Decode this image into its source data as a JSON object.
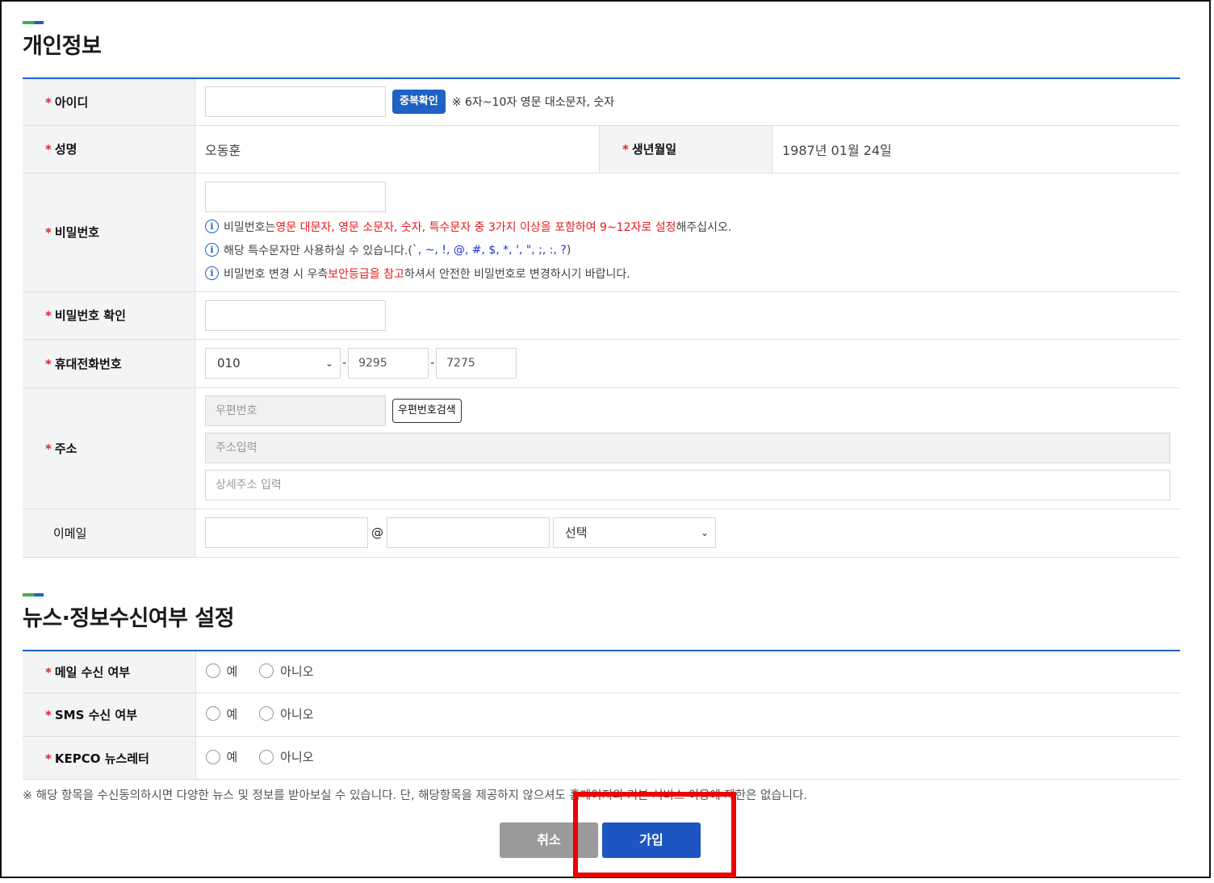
{
  "personal": {
    "title": "개인정보",
    "id_label": "아이디",
    "id_check_button": "중복확인",
    "id_note": "※ 6자~10자 영문 대소문자, 숫자",
    "name_label": "성명",
    "name_value": "오동훈",
    "birth_label": "생년월일",
    "birth_value": "1987년 01월 24일",
    "password_label": "비밀번호",
    "pw_notes": {
      "line1_a": "비밀번호는 ",
      "line1_red": "영문 대문자, 영문 소문자, 숫자, 특수문자 중 3가지 이상을 포함하여 9~12자로 설정",
      "line1_b": "해주십시오.",
      "line2_a": "해당 특수문자만 사용하실 수 있습니다.(",
      "line2_symbols": " `,  ~,  !,  @,  #,  $,  *,  ',  \",  ;,  :,  ?",
      "line2_b": ")",
      "line3_a": "비밀번호 변경 시 우측 ",
      "line3_red": "보안등급을 참고",
      "line3_b": "하셔서 안전한 비밀번호로 변경하시기 바랍니다."
    },
    "password_confirm_label": "비밀번호 확인",
    "phone_label": "휴대전화번호",
    "phone_prefix": "010",
    "phone_mid": "9295",
    "phone_last": "7275",
    "phone_dash": "-",
    "address_label": "주소",
    "postcode_placeholder": "우편번호",
    "postcode_search_button": "우편번호검색",
    "address_placeholder": "주소입력",
    "address_detail_placeholder": "상세주소 입력",
    "email_label": "이메일",
    "email_at": "@",
    "email_domain_select": "선택"
  },
  "news": {
    "title": "뉴스·정보수신여부 설정",
    "rows": [
      {
        "label": "메일 수신 여부",
        "yes": "예",
        "no": "아니오"
      },
      {
        "label": "SMS 수신 여부",
        "yes": "예",
        "no": "아니오"
      },
      {
        "label": "KEPCO 뉴스레터",
        "yes": "예",
        "no": "아니오"
      }
    ],
    "footnote": "※ 해당 항목을 수신동의하시면 다양한 뉴스 및 정보를 받아보실 수 있습니다. 단, 해당항목을 제공하지 않으셔도 홈페이지의 기본 서비스 이용에 제한은 없습니다."
  },
  "actions": {
    "cancel": "취소",
    "join": "가입"
  },
  "required_mark": "*",
  "colors": {
    "accent_blue": "#1d62c4",
    "required_red": "#d9262b",
    "highlight_red": "#ee0000",
    "cancel_gray": "#9a9a9a"
  }
}
